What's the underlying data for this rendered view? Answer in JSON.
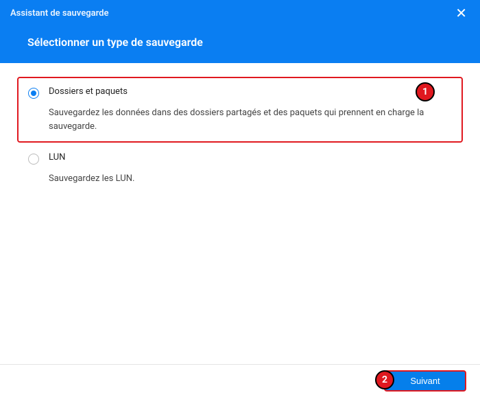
{
  "window": {
    "title": "Assistant de sauvegarde",
    "subtitle": "Sélectionner un type de sauvegarde"
  },
  "options": {
    "folders": {
      "label": "Dossiers et paquets",
      "desc": "Sauvegardez les données dans des dossiers partagés et des paquets qui prennent en charge la sauvegarde."
    },
    "lun": {
      "label": "LUN",
      "desc": "Sauvegardez les LUN."
    }
  },
  "footer": {
    "next_label": "Suivant"
  },
  "annotations": {
    "step1": "1",
    "step2": "2"
  }
}
